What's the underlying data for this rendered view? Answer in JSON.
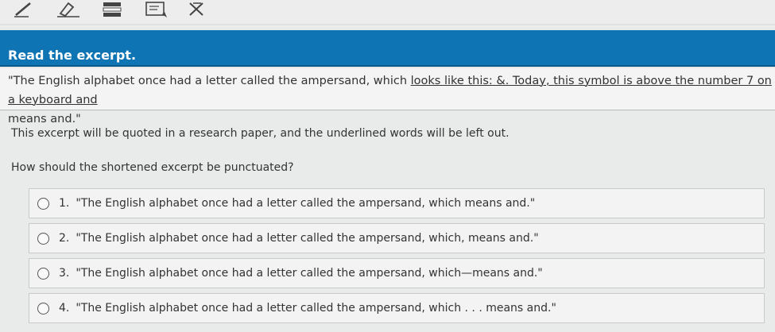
{
  "toolbar": {
    "tools": [
      {
        "name": "pencil-icon"
      },
      {
        "name": "highlighter-icon"
      },
      {
        "name": "line-reader-icon"
      },
      {
        "name": "reference-icon"
      },
      {
        "name": "answer-eliminator-icon"
      }
    ]
  },
  "header": {
    "title": "Read the excerpt."
  },
  "excerpt": {
    "part1": "\"The English alphabet once had a letter called the ampersand, which ",
    "underlined": "looks like this: &. Today, this symbol is above the number 7 on a keyboard and",
    "part2": "means and.\""
  },
  "prompt1": "This excerpt will be quoted in a research paper, and the underlined words will be left out.",
  "prompt2": "How should the shortened excerpt be punctuated?",
  "choices": [
    {
      "num": "1.",
      "text": "\"The English alphabet once had a letter called the ampersand, which means and.\""
    },
    {
      "num": "2.",
      "text": "\"The English alphabet once had a letter called the ampersand, which, means and.\""
    },
    {
      "num": "3.",
      "text": "\"The English alphabet once had a letter called the ampersand, which—means and.\""
    },
    {
      "num": "4.",
      "text": "\"The English alphabet once had a letter called the ampersand, which . . . means and.\""
    }
  ]
}
